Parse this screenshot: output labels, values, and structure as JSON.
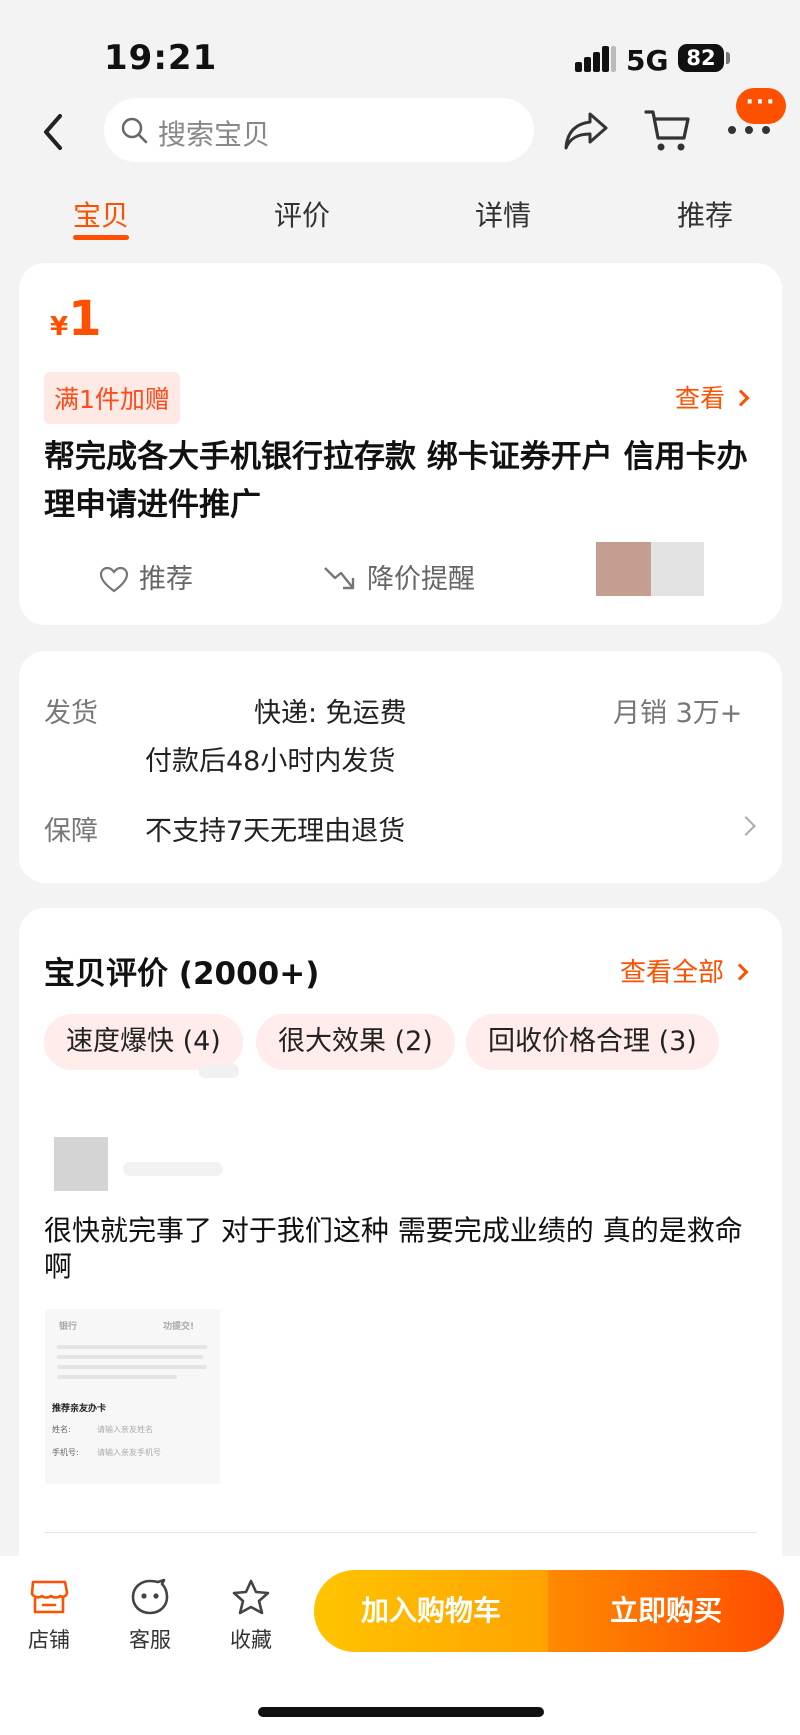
{
  "status_bar": {
    "time": "19:21",
    "network": "5G",
    "battery": "82"
  },
  "search": {
    "placeholder": "搜索宝贝"
  },
  "message_badge": "···",
  "tabs": [
    {
      "label": "宝贝",
      "active": true
    },
    {
      "label": "评价",
      "active": false
    },
    {
      "label": "详情",
      "active": false
    },
    {
      "label": "推荐",
      "active": false
    }
  ],
  "product": {
    "currency": "¥",
    "price": "1",
    "promo_tag": "满1件加赠",
    "promo_link": "查看",
    "title": "帮完成各大手机银行拉存款 绑卡证券开户 信用卡办理申请进件推广",
    "actions": {
      "recommend": "推荐",
      "price_alert": "降价提醒"
    }
  },
  "shipping": {
    "label": "发货",
    "method": "快递: 免运费",
    "sales": "月销 3万+",
    "time": "付款后48小时内发货",
    "guarantee_label": "保障",
    "guarantee": "不支持7天无理由退货"
  },
  "reviews": {
    "title": "宝贝评价 (2000+)",
    "view_all": "查看全部",
    "tags": [
      {
        "label": "速度爆快 (4)"
      },
      {
        "label": "很大效果 (2)"
      },
      {
        "label": "回收价格合理 (3)"
      }
    ],
    "first_review": {
      "text": "很快就完事了 对于我们这种 需要完成业绩的 真的是救命啊",
      "image": {
        "heading_left": "银行",
        "heading_right": "功提交!",
        "form_title": "推荐亲友办卡",
        "name_label": "姓名:",
        "name_placeholder": "请输入亲友姓名",
        "phone_label": "手机号:",
        "phone_placeholder": "请输入亲友手机号"
      }
    }
  },
  "bottom_bar": {
    "shop": "店铺",
    "service": "客服",
    "favorite": "收藏",
    "add_to_cart": "加入购物车",
    "buy_now": "立即购买"
  },
  "colors": {
    "accent": "#ff5000",
    "cart_button": "#ffb300",
    "buy_button": "#ff5a00"
  }
}
